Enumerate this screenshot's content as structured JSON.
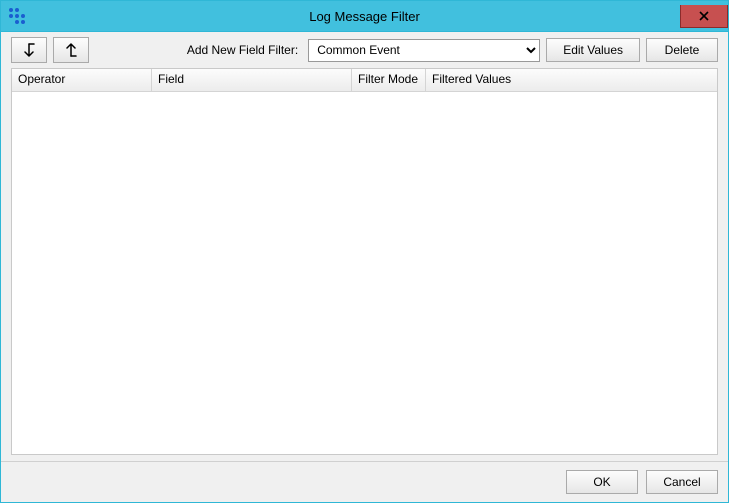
{
  "window": {
    "title": "Log Message Filter"
  },
  "toolbar": {
    "add_label": "Add New Field Filter:",
    "combo_value": "Common Event",
    "edit_values_label": "Edit Values",
    "delete_label": "Delete"
  },
  "grid": {
    "headers": {
      "operator": "Operator",
      "field": "Field",
      "mode": "Filter Mode",
      "values": "Filtered Values"
    },
    "rows": []
  },
  "buttons": {
    "ok": "OK",
    "cancel": "Cancel"
  }
}
